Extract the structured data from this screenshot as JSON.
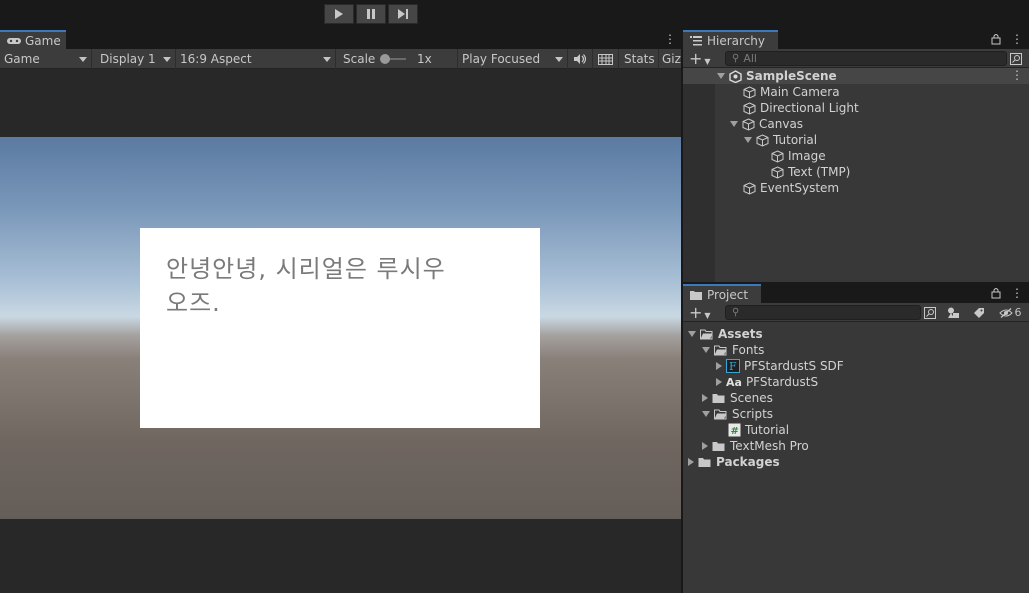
{
  "toolbar": {
    "play_icon": "play-icon",
    "pause_icon": "pause-icon",
    "step_icon": "step-icon"
  },
  "game": {
    "tab_label": "Game",
    "mode_select": "Game",
    "display_select": "Display 1",
    "aspect_select": "16:9 Aspect",
    "scale_label": "Scale",
    "scale_value": "1x",
    "play_mode_select": "Play Focused",
    "stats_label": "Stats",
    "gizmos_label": "Giz",
    "dialog_text_line1": "안녕안녕, 시리얼은 루시우",
    "dialog_text_line2": "오즈."
  },
  "hierarchy": {
    "tab_label": "Hierarchy",
    "search_placeholder": "All",
    "items": [
      {
        "label": "SampleScene"
      },
      {
        "label": "Main Camera"
      },
      {
        "label": "Directional Light"
      },
      {
        "label": "Canvas"
      },
      {
        "label": "Tutorial"
      },
      {
        "label": "Image"
      },
      {
        "label": "Text (TMP)"
      },
      {
        "label": "EventSystem"
      }
    ]
  },
  "project": {
    "tab_label": "Project",
    "search_placeholder": "",
    "hidden_count": "6",
    "items": [
      {
        "label": "Assets"
      },
      {
        "label": "Fonts"
      },
      {
        "label": "PFStardustS SDF"
      },
      {
        "label": "PFStardustS"
      },
      {
        "label": "Scenes"
      },
      {
        "label": "Scripts"
      },
      {
        "label": "Tutorial"
      },
      {
        "label": "TextMesh Pro"
      },
      {
        "label": "Packages"
      }
    ]
  },
  "colors": {
    "accent": "#3a79bb",
    "panel": "#383838",
    "dialog_bg": "#ffffff"
  }
}
